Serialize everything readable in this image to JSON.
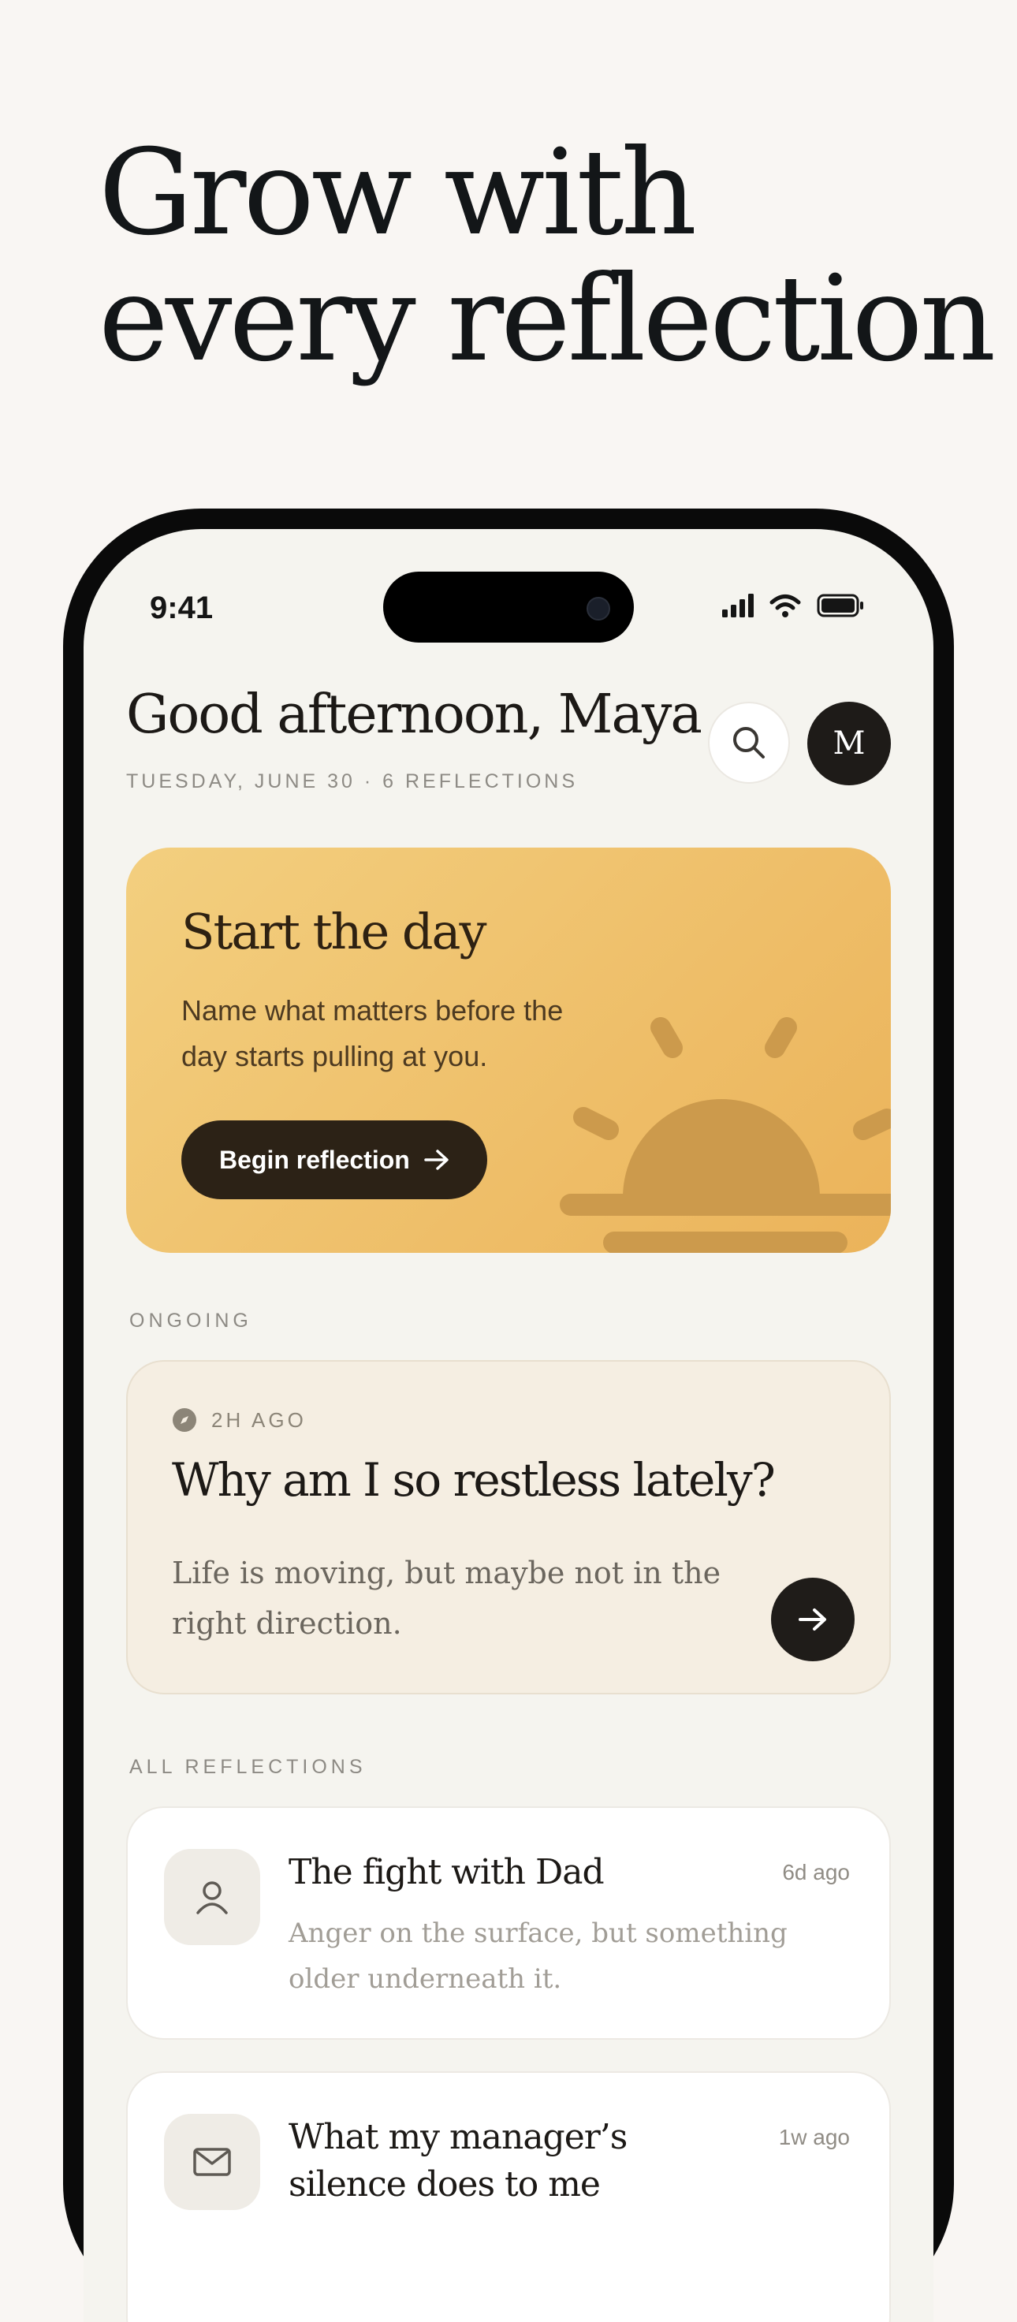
{
  "headline": {
    "line1": "Grow with",
    "line2": "every reflection"
  },
  "status_bar": {
    "time": "9:41"
  },
  "header": {
    "greeting": "Good afternoon, Maya",
    "subline": "TUESDAY, JUNE 30 · 6 REFLECTIONS",
    "avatar_initial": "M",
    "search_icon": "search-icon"
  },
  "hero": {
    "title": "Start the day",
    "subtitle": "Name what matters before the day starts pulling at you.",
    "button_label": "Begin reflection",
    "colors": {
      "start": "#f3cf7f",
      "end": "#ebb35a",
      "button": "#2c2216"
    }
  },
  "ongoing": {
    "section_label": "ONGOING",
    "time_ago": "2H AGO",
    "title": "Why am I so restless lately?",
    "body": "Life is moving, but maybe not in the right direction."
  },
  "all_reflections": {
    "section_label": "ALL REFLECTIONS",
    "items": [
      {
        "icon": "person-icon",
        "title": "The fight with Dad",
        "time": "6d ago",
        "body": "Anger on the surface, but something older underneath it."
      },
      {
        "icon": "mail-icon",
        "title": "What my manager’s silence does to me",
        "time": "1w ago",
        "body": ""
      }
    ]
  }
}
